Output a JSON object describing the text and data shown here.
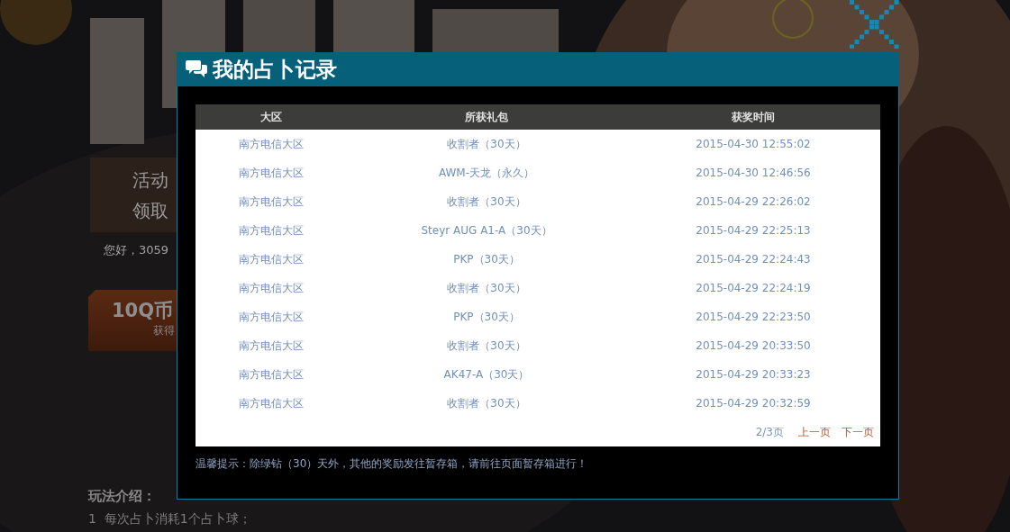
{
  "background": {
    "promo_box": {
      "lines": [
        "活动",
        "领取"
      ]
    },
    "greeting": "您好，3059",
    "reward_card": {
      "amount": "10Q币",
      "caption": "获得"
    },
    "rules": {
      "heading": "玩法介绍：",
      "items": [
        "1  每次占卜消耗1个占卜球；"
      ]
    }
  },
  "dialog": {
    "title": "我的占卜记录",
    "columns": [
      "大区",
      "所获礼包",
      "获奖时间"
    ],
    "rows": [
      [
        "南方电信大区",
        "收割者（30天）",
        "2015-04-30 12:55:02"
      ],
      [
        "南方电信大区",
        "AWM-天龙（永久）",
        "2015-04-30 12:46:56"
      ],
      [
        "南方电信大区",
        "收割者（30天）",
        "2015-04-29 22:26:02"
      ],
      [
        "南方电信大区",
        "Steyr AUG A1-A（30天）",
        "2015-04-29 22:25:13"
      ],
      [
        "南方电信大区",
        "PKP（30天）",
        "2015-04-29 22:24:43"
      ],
      [
        "南方电信大区",
        "收割者（30天）",
        "2015-04-29 22:24:19"
      ],
      [
        "南方电信大区",
        "PKP（30天）",
        "2015-04-29 22:23:50"
      ],
      [
        "南方电信大区",
        "收割者（30天）",
        "2015-04-29 20:33:50"
      ],
      [
        "南方电信大区",
        "AK47-A（30天）",
        "2015-04-29 20:33:23"
      ],
      [
        "南方电信大区",
        "收割者（30天）",
        "2015-04-29 20:32:59"
      ]
    ],
    "pager": {
      "page": "2/3页",
      "prev": "上一页",
      "next": "下一页"
    },
    "tip": "温馨提示：除绿钻（30）天外，其他的奖励发往暂存箱，请前往页面暂存箱进行！"
  }
}
